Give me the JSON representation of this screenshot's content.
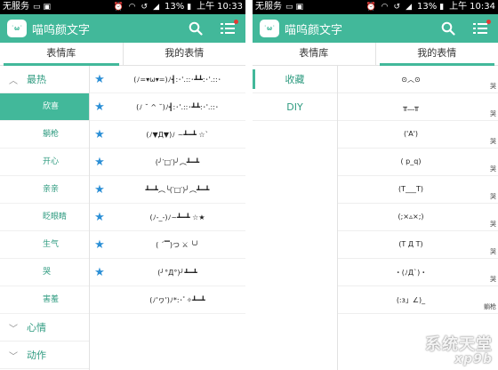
{
  "colors": {
    "accent": "#42b89a",
    "star": "#2b8fd6",
    "badge": "#e53935"
  },
  "left": {
    "status": {
      "carrier": "无服务",
      "battery": "13%",
      "ampm": "上午",
      "time": "10:33"
    },
    "app_title": "喵呜颜文字",
    "logo_text": "˙ω˙",
    "tabs": [
      "表情库",
      "我的表情"
    ],
    "category_open": "最热",
    "subcategories": [
      "欣喜",
      "躺枪",
      "开心",
      "亲亲",
      "眨眼睛",
      "生气",
      "哭",
      "害羞"
    ],
    "categories_closed": [
      "心情",
      "动作"
    ],
    "emoticons": [
      {
        "text": "(ﾉ=▾ω▾=)ﾉ┫:･'.::･┻┻:･'.::･",
        "starred": true
      },
      {
        "text": "(ﾉ ˘ ^ ˘)ﾉ┫:･'.::･┻┻:･'.::･",
        "starred": true
      },
      {
        "text": "(ﾉ▼Д▼)ﾉ ~┻━┻ ☆`",
        "starred": true
      },
      {
        "text": "(╯‵□′)╯︵┻━┻",
        "starred": true
      },
      {
        "text": "┻━┻︵╰(‵□′)╯︵┻━┻",
        "starred": true
      },
      {
        "text": "(ﾉ-_-)ﾉ~┻━┻ ☆★",
        "starred": true
      },
      {
        "text": "( ´▔)つ ⚔ ╰╯",
        "starred": true
      },
      {
        "text": "(╯°Д°)╯┻━┻",
        "starred": true
      },
      {
        "text": "(ﾉ'ヮ')ﾉ*:･ﾟ✧┻━┻",
        "starred": false
      }
    ]
  },
  "right": {
    "status": {
      "carrier": "无服务",
      "battery": "13%",
      "ampm": "上午",
      "time": "10:34"
    },
    "app_title": "喵呜颜文字",
    "logo_text": "˙ω˙",
    "tabs": [
      "表情库",
      "我的表情"
    ],
    "side_items": [
      "收藏",
      "DIY"
    ],
    "emoticons": [
      "⊙︿⊙",
      "╥﹏╥",
      "('A')",
      "( p_q)",
      "(T___T)",
      "(;×▵×;)",
      "(T Д T)",
      "・(ﾉД`)・",
      "(:з」∠)_"
    ],
    "delete_label": "哭",
    "more_label": "躺枪"
  },
  "watermark": {
    "line1": "系统天堂",
    "line2": "xp9b"
  }
}
